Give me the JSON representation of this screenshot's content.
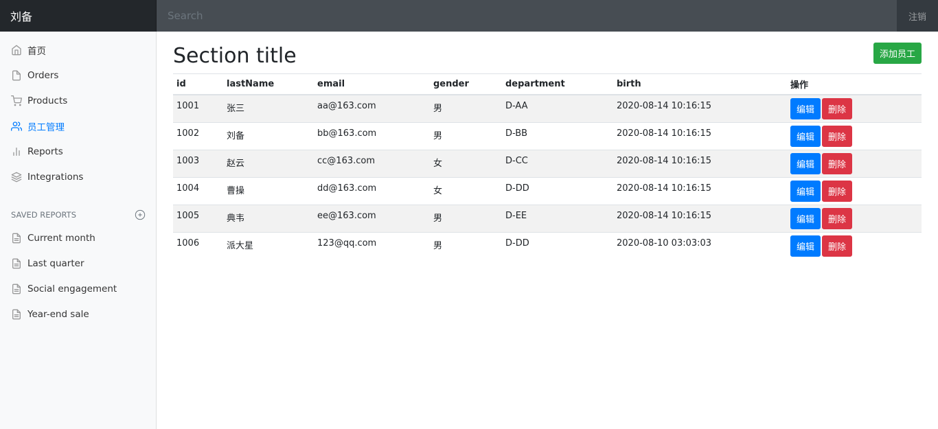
{
  "navbar": {
    "brand": "刘备",
    "search_placeholder": "Search",
    "signout": "注销"
  },
  "sidebar": {
    "items": [
      {
        "label": "首页",
        "icon": "home-icon"
      },
      {
        "label": "Orders",
        "icon": "file-icon"
      },
      {
        "label": "Products",
        "icon": "shopping-cart-icon"
      },
      {
        "label": "员工管理",
        "icon": "users-icon",
        "active": true
      },
      {
        "label": "Reports",
        "icon": "bar-chart-icon"
      },
      {
        "label": "Integrations",
        "icon": "layers-icon"
      }
    ],
    "saved_heading": "SAVED REPORTS",
    "saved": [
      {
        "label": "Current month",
        "icon": "file-text-icon"
      },
      {
        "label": "Last quarter",
        "icon": "file-text-icon"
      },
      {
        "label": "Social engagement",
        "icon": "file-text-icon"
      },
      {
        "label": "Year-end sale",
        "icon": "file-text-icon"
      }
    ]
  },
  "main": {
    "title": "Section title",
    "add_button": "添加员工",
    "columns": [
      "id",
      "lastName",
      "email",
      "gender",
      "department",
      "birth",
      "操作"
    ],
    "rows": [
      [
        "1001",
        "张三",
        "aa@163.com",
        "男",
        "D-AA",
        "2020-08-14 10:16:15"
      ],
      [
        "1002",
        "刘备",
        "bb@163.com",
        "男",
        "D-BB",
        "2020-08-14 10:16:15"
      ],
      [
        "1003",
        "赵云",
        "cc@163.com",
        "女",
        "D-CC",
        "2020-08-14 10:16:15"
      ],
      [
        "1004",
        "曹操",
        "dd@163.com",
        "女",
        "D-DD",
        "2020-08-14 10:16:15"
      ],
      [
        "1005",
        "典韦",
        "ee@163.com",
        "男",
        "D-EE",
        "2020-08-14 10:16:15"
      ],
      [
        "1006",
        "派大星",
        "123@qq.com",
        "男",
        "D-DD",
        "2020-08-10 03:03:03"
      ]
    ],
    "edit_label": "编辑",
    "delete_label": "删除"
  },
  "colors": {
    "accent": "#007bff",
    "success": "#28a745",
    "danger": "#dc3545",
    "navbar": "#343a40"
  }
}
